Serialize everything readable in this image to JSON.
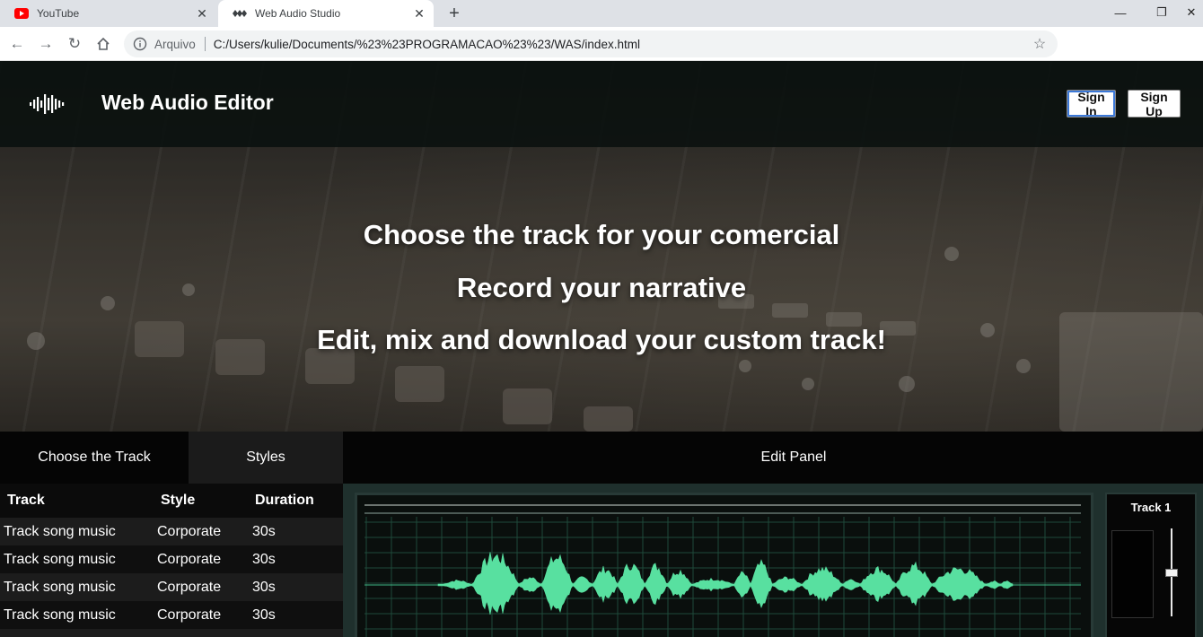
{
  "browser": {
    "tabs": [
      {
        "title": "YouTube",
        "active": false,
        "icon": "youtube-icon"
      },
      {
        "title": "Web Audio Studio",
        "active": true,
        "icon": "waveform-icon"
      }
    ],
    "omnibox": {
      "scheme_label": "Arquivo",
      "url": "C:/Users/kulie/Documents/%23%23PROGRAMACAO%23%23/WAS/index.html"
    },
    "window_controls": {
      "minimize": "—",
      "maximize": "❐",
      "close": "✕"
    }
  },
  "header": {
    "brand": "Web Audio Editor",
    "sign_in_label": "Sign In",
    "sign_up_label": "Sign Up"
  },
  "hero": {
    "line1": "Choose the track for your comercial",
    "line2": "Record your narrative",
    "line3": "Edit, mix and download your custom track!"
  },
  "tabs": {
    "choose": "Choose the Track",
    "styles": "Styles",
    "edit": "Edit Panel"
  },
  "tracks": {
    "columns": [
      "Track",
      "Style",
      "Duration"
    ],
    "rows": [
      {
        "track": "Track song music",
        "style": "Corporate",
        "duration": "30s"
      },
      {
        "track": "Track song music",
        "style": "Corporate",
        "duration": "30s"
      },
      {
        "track": "Track song music",
        "style": "Corporate",
        "duration": "30s"
      },
      {
        "track": "Track song music",
        "style": "Corporate",
        "duration": "30s"
      }
    ]
  },
  "editor": {
    "track_label": "Track 1",
    "waveform_color": "#58e0a0",
    "grid_color": "#1f4a3a"
  },
  "colors": {
    "accent_focus": "#3b78d8",
    "youtube_red": "#ff0000"
  }
}
